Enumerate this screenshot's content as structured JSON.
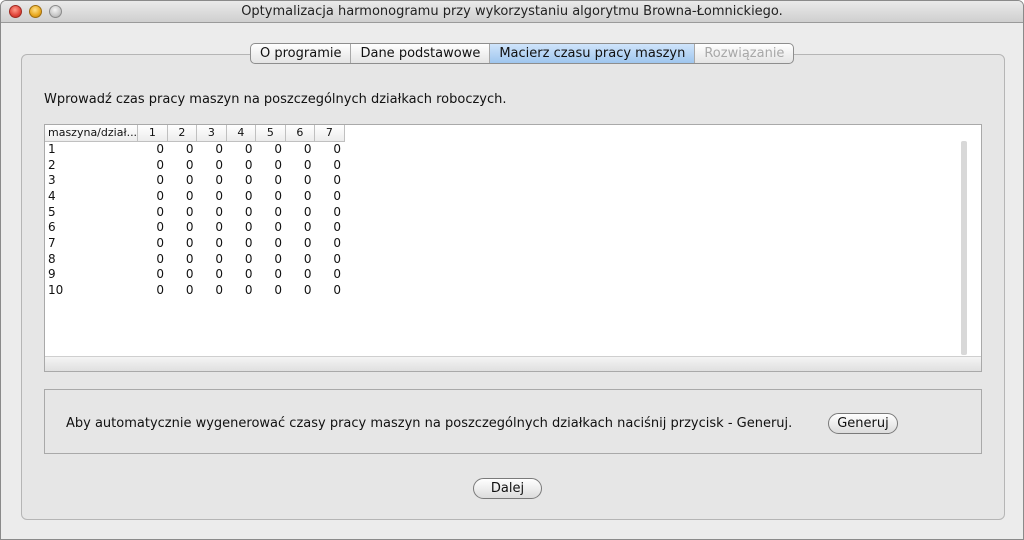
{
  "window": {
    "title": "Optymalizacja harmonogramu przy wykorzystaniu algorytmu Browna-Łomnickiego."
  },
  "tabs": [
    {
      "label": "O programie",
      "state": "normal"
    },
    {
      "label": "Dane podstawowe",
      "state": "normal"
    },
    {
      "label": "Macierz czasu pracy maszyn",
      "state": "active"
    },
    {
      "label": "Rozwiązanie",
      "state": "disabled"
    }
  ],
  "instruction": "Wprowadź czas pracy maszyn na poszczególnych działkach roboczych.",
  "table": {
    "corner_header": "maszyna/dział...",
    "columns": [
      "1",
      "2",
      "3",
      "4",
      "5",
      "6",
      "7"
    ],
    "rows": [
      {
        "label": "1",
        "values": [
          "0",
          "0",
          "0",
          "0",
          "0",
          "0",
          "0"
        ]
      },
      {
        "label": "2",
        "values": [
          "0",
          "0",
          "0",
          "0",
          "0",
          "0",
          "0"
        ]
      },
      {
        "label": "3",
        "values": [
          "0",
          "0",
          "0",
          "0",
          "0",
          "0",
          "0"
        ]
      },
      {
        "label": "4",
        "values": [
          "0",
          "0",
          "0",
          "0",
          "0",
          "0",
          "0"
        ]
      },
      {
        "label": "5",
        "values": [
          "0",
          "0",
          "0",
          "0",
          "0",
          "0",
          "0"
        ]
      },
      {
        "label": "6",
        "values": [
          "0",
          "0",
          "0",
          "0",
          "0",
          "0",
          "0"
        ]
      },
      {
        "label": "7",
        "values": [
          "0",
          "0",
          "0",
          "0",
          "0",
          "0",
          "0"
        ]
      },
      {
        "label": "8",
        "values": [
          "0",
          "0",
          "0",
          "0",
          "0",
          "0",
          "0"
        ]
      },
      {
        "label": "9",
        "values": [
          "0",
          "0",
          "0",
          "0",
          "0",
          "0",
          "0"
        ]
      },
      {
        "label": "10",
        "values": [
          "0",
          "0",
          "0",
          "0",
          "0",
          "0",
          "0"
        ]
      }
    ]
  },
  "generate": {
    "text": "Aby automatycznie wygenerować czasy pracy maszyn na poszczególnych działkach naciśnij przycisk - Generuj.",
    "button_label": "Generuj"
  },
  "footer": {
    "next_label": "Dalej"
  }
}
